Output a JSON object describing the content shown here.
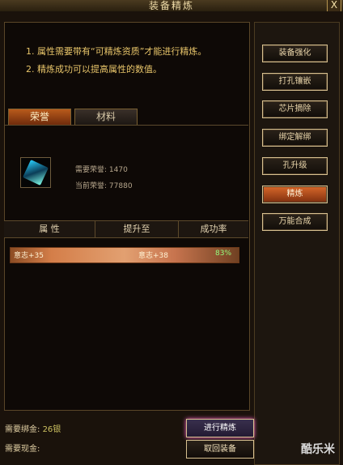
{
  "window": {
    "title": "装备精炼",
    "close_label": "X"
  },
  "tips": {
    "line1": "1. 属性需要带有“可精炼资质”才能进行精炼。",
    "line2": "2. 精炼成功可以提高属性的数值。"
  },
  "tabs": {
    "honor": "荣誉",
    "material": "材料"
  },
  "item": {
    "required_honor_label": "需要荣誉:",
    "required_honor_value": "1470",
    "current_honor_label": "当前荣誉:",
    "current_honor_value": "77880"
  },
  "table": {
    "headers": [
      "属 性",
      "提升至",
      "成功率"
    ],
    "row": {
      "attribute": "意志+35",
      "upgrade_to": "意志+38",
      "success_rate": "83%"
    }
  },
  "bottom": {
    "bind_gold_label": "需要绑金:",
    "bind_gold_value": "26银",
    "cash_label": "需要现金:",
    "refine_button": "进行精炼",
    "retrieve_button": "取回装备"
  },
  "sidebar": {
    "buttons": [
      "装备强化",
      "打孔镶嵌",
      "芯片摘除",
      "绑定解绑",
      "孔升级",
      "精炼",
      "万能合成"
    ]
  },
  "watermark": "酷乐米"
}
